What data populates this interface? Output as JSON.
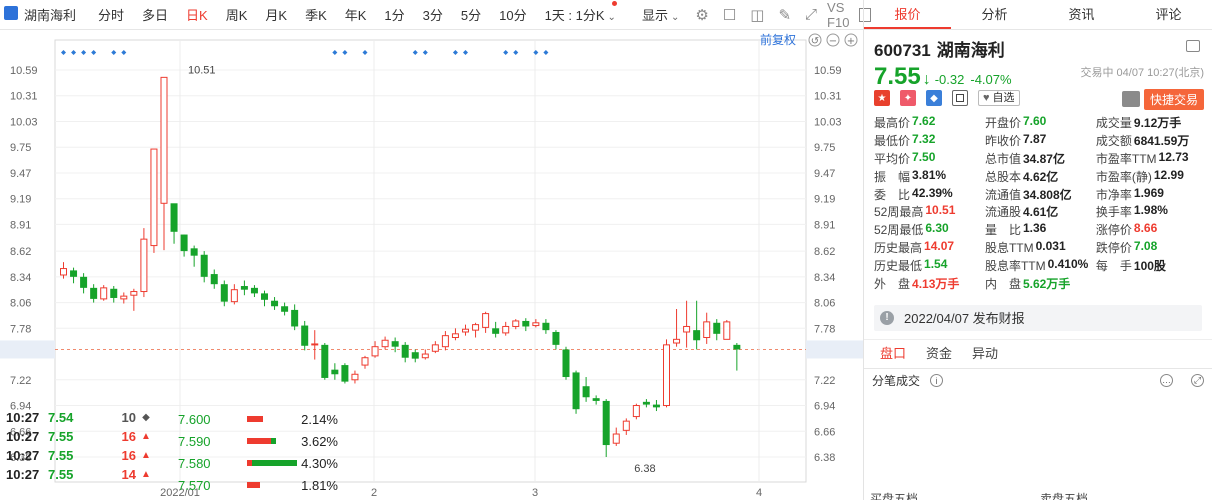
{
  "toolbar": {
    "title": "湖南海利",
    "items": [
      "分时",
      "多日",
      "日K",
      "周K",
      "月K",
      "季K",
      "年K",
      "1分",
      "3分",
      "5分",
      "10分",
      "1天 : 1分K"
    ],
    "active": "日K",
    "display": "显示",
    "vs_fio": "VS F10"
  },
  "chart_overlay": {
    "fq": "前复权",
    "high_label": "10.51",
    "low_label": "6.38",
    "current_label": "7.55"
  },
  "chart_data": {
    "type": "candlestick",
    "y_ticks": [
      "10.59",
      "10.31",
      "10.03",
      "9.75",
      "9.47",
      "9.19",
      "8.91",
      "8.62",
      "8.34",
      "8.06",
      "7.78",
      "7.55",
      "7.22",
      "6.94",
      "6.66",
      "6.38"
    ],
    "x_ticks": [
      "2022/01",
      "2",
      "3",
      "4"
    ],
    "current_price": 7.55,
    "candles": [
      {
        "o": 8.36,
        "c": 8.43,
        "h": 8.5,
        "l": 8.32
      },
      {
        "o": 8.41,
        "c": 8.34,
        "h": 8.44,
        "l": 8.27
      },
      {
        "o": 8.34,
        "c": 8.22,
        "h": 8.38,
        "l": 8.16
      },
      {
        "o": 8.22,
        "c": 8.1,
        "h": 8.26,
        "l": 8.06
      },
      {
        "o": 8.1,
        "c": 8.22,
        "h": 8.25,
        "l": 8.08
      },
      {
        "o": 8.21,
        "c": 8.11,
        "h": 8.24,
        "l": 8.06
      },
      {
        "o": 8.1,
        "c": 8.13,
        "h": 8.17,
        "l": 8.05
      },
      {
        "o": 8.14,
        "c": 8.18,
        "h": 8.21,
        "l": 7.97
      },
      {
        "o": 8.18,
        "c": 8.75,
        "h": 8.87,
        "l": 8.12
      },
      {
        "o": 8.68,
        "c": 9.73,
        "h": 9.73,
        "l": 8.6
      },
      {
        "o": 9.14,
        "c": 10.51,
        "h": 10.51,
        "l": 8.63
      },
      {
        "o": 9.14,
        "c": 8.83,
        "h": 9.08,
        "l": 8.7
      },
      {
        "o": 8.8,
        "c": 8.62,
        "h": 8.8,
        "l": 8.56
      },
      {
        "o": 8.65,
        "c": 8.57,
        "h": 8.68,
        "l": 8.45
      },
      {
        "o": 8.58,
        "c": 8.34,
        "h": 8.62,
        "l": 8.28
      },
      {
        "o": 8.37,
        "c": 8.26,
        "h": 8.42,
        "l": 8.21
      },
      {
        "o": 8.26,
        "c": 8.07,
        "h": 8.3,
        "l": 8.02
      },
      {
        "o": 8.07,
        "c": 8.2,
        "h": 8.26,
        "l": 8.04
      },
      {
        "o": 8.24,
        "c": 8.2,
        "h": 8.3,
        "l": 8.14
      },
      {
        "o": 8.22,
        "c": 8.16,
        "h": 8.25,
        "l": 8.12
      },
      {
        "o": 8.16,
        "c": 8.09,
        "h": 8.19,
        "l": 8.02
      },
      {
        "o": 8.08,
        "c": 8.02,
        "h": 8.12,
        "l": 7.98
      },
      {
        "o": 8.02,
        "c": 7.96,
        "h": 8.06,
        "l": 7.92
      },
      {
        "o": 7.98,
        "c": 7.8,
        "h": 8.04,
        "l": 7.76
      },
      {
        "o": 7.81,
        "c": 7.59,
        "h": 7.86,
        "l": 7.54
      },
      {
        "o": 7.61,
        "c": 7.61,
        "h": 7.76,
        "l": 7.44
      },
      {
        "o": 7.6,
        "c": 7.24,
        "h": 7.62,
        "l": 7.22
      },
      {
        "o": 7.33,
        "c": 7.28,
        "h": 7.4,
        "l": 7.22
      },
      {
        "o": 7.38,
        "c": 7.2,
        "h": 7.4,
        "l": 7.18
      },
      {
        "o": 7.22,
        "c": 7.28,
        "h": 7.32,
        "l": 7.18
      },
      {
        "o": 7.38,
        "c": 7.46,
        "h": 7.48,
        "l": 7.34
      },
      {
        "o": 7.48,
        "c": 7.58,
        "h": 7.64,
        "l": 7.46
      },
      {
        "o": 7.58,
        "c": 7.65,
        "h": 7.69,
        "l": 7.55
      },
      {
        "o": 7.64,
        "c": 7.58,
        "h": 7.68,
        "l": 7.52
      },
      {
        "o": 7.6,
        "c": 7.46,
        "h": 7.63,
        "l": 7.41
      },
      {
        "o": 7.52,
        "c": 7.45,
        "h": 7.55,
        "l": 7.41
      },
      {
        "o": 7.46,
        "c": 7.5,
        "h": 7.55,
        "l": 7.44
      },
      {
        "o": 7.53,
        "c": 7.6,
        "h": 7.64,
        "l": 7.51
      },
      {
        "o": 7.58,
        "c": 7.7,
        "h": 7.75,
        "l": 7.54
      },
      {
        "o": 7.68,
        "c": 7.72,
        "h": 7.78,
        "l": 7.65
      },
      {
        "o": 7.74,
        "c": 7.77,
        "h": 7.82,
        "l": 7.7
      },
      {
        "o": 7.76,
        "c": 7.82,
        "h": 7.84,
        "l": 7.68
      },
      {
        "o": 7.79,
        "c": 7.94,
        "h": 7.96,
        "l": 7.73
      },
      {
        "o": 7.78,
        "c": 7.72,
        "h": 7.85,
        "l": 7.68
      },
      {
        "o": 7.73,
        "c": 7.8,
        "h": 7.85,
        "l": 7.7
      },
      {
        "o": 7.8,
        "c": 7.86,
        "h": 7.88,
        "l": 7.77
      },
      {
        "o": 7.86,
        "c": 7.8,
        "h": 7.89,
        "l": 7.75
      },
      {
        "o": 7.81,
        "c": 7.84,
        "h": 7.88,
        "l": 7.79
      },
      {
        "o": 7.84,
        "c": 7.76,
        "h": 7.88,
        "l": 7.72
      },
      {
        "o": 7.74,
        "c": 7.6,
        "h": 7.76,
        "l": 7.55
      },
      {
        "o": 7.55,
        "c": 7.25,
        "h": 7.58,
        "l": 7.22
      },
      {
        "o": 7.3,
        "c": 6.9,
        "h": 7.32,
        "l": 6.85
      },
      {
        "o": 7.15,
        "c": 7.03,
        "h": 7.25,
        "l": 6.98
      },
      {
        "o": 7.02,
        "c": 6.99,
        "h": 7.05,
        "l": 6.95
      },
      {
        "o": 6.99,
        "c": 6.51,
        "h": 7.01,
        "l": 6.38
      },
      {
        "o": 6.53,
        "c": 6.63,
        "h": 6.7,
        "l": 6.5
      },
      {
        "o": 6.67,
        "c": 6.77,
        "h": 6.8,
        "l": 6.62
      },
      {
        "o": 6.82,
        "c": 6.94,
        "h": 6.96,
        "l": 6.79
      },
      {
        "o": 6.98,
        "c": 6.95,
        "h": 7.01,
        "l": 6.92
      },
      {
        "o": 6.95,
        "c": 6.92,
        "h": 7.0,
        "l": 6.88
      },
      {
        "o": 6.94,
        "c": 7.6,
        "h": 7.66,
        "l": 6.92
      },
      {
        "o": 7.62,
        "c": 7.66,
        "h": 7.99,
        "l": 7.58
      },
      {
        "o": 7.74,
        "c": 7.8,
        "h": 8.08,
        "l": 7.57
      },
      {
        "o": 7.76,
        "c": 7.65,
        "h": 8.08,
        "l": 7.55
      },
      {
        "o": 7.68,
        "c": 7.85,
        "h": 7.95,
        "l": 7.61
      },
      {
        "o": 7.84,
        "c": 7.72,
        "h": 7.88,
        "l": 7.65
      },
      {
        "o": 7.66,
        "c": 7.85,
        "h": 7.87,
        "l": 7.66
      },
      {
        "o": 7.6,
        "c": 7.55,
        "h": 7.62,
        "l": 7.32
      }
    ],
    "markers_x": [
      0,
      1,
      2,
      3,
      5,
      6,
      27,
      28,
      30,
      35,
      36,
      39,
      40,
      44,
      45,
      47,
      48
    ]
  },
  "quote_tabs": [
    "报价",
    "分析",
    "资讯",
    "评论"
  ],
  "quote_active": "报价",
  "stock": {
    "code": "600731",
    "name": "湖南海利",
    "price": "7.55",
    "change": "-0.32",
    "change_pct": "-4.07%",
    "time": "交易中 04/07 10:27(北京)",
    "zixuan": "自选",
    "quick_trade": "快捷交易"
  },
  "stats": [
    [
      [
        "最高价",
        "7.62",
        "green"
      ],
      [
        "开盘价",
        "7.60",
        "green"
      ],
      [
        "成交量",
        "9.12万手",
        ""
      ]
    ],
    [
      [
        "最低价",
        "7.32",
        "green"
      ],
      [
        "昨收价",
        "7.87",
        ""
      ],
      [
        "成交额",
        "6841.59万",
        ""
      ]
    ],
    [
      [
        "平均价",
        "7.50",
        "green"
      ],
      [
        "总市值",
        "34.87亿",
        ""
      ],
      [
        "市盈率TTM",
        "12.73",
        ""
      ]
    ],
    [
      [
        "振　幅",
        "3.81%",
        ""
      ],
      [
        "总股本",
        "4.62亿",
        ""
      ],
      [
        "市盈率(静)",
        "12.99",
        ""
      ]
    ],
    [
      [
        "委　比",
        "42.39%",
        ""
      ],
      [
        "流通值",
        "34.808亿",
        ""
      ],
      [
        "市净率",
        "1.969",
        ""
      ]
    ],
    [
      [
        "52周最高",
        "10.51",
        "red"
      ],
      [
        "流通股",
        "4.61亿",
        ""
      ],
      [
        "换手率",
        "1.98%",
        ""
      ]
    ],
    [
      [
        "52周最低",
        "6.30",
        "green"
      ],
      [
        "量　比",
        "1.36",
        ""
      ],
      [
        "涨停价",
        "8.66",
        "red"
      ]
    ],
    [
      [
        "历史最高",
        "14.07",
        "red"
      ],
      [
        "股息TTM",
        "0.031",
        ""
      ],
      [
        "跌停价",
        "7.08",
        "green"
      ]
    ],
    [
      [
        "历史最低",
        "1.54",
        "green"
      ],
      [
        "股息率TTM",
        "0.410%",
        ""
      ],
      [
        "每　手",
        "100股",
        ""
      ]
    ],
    [
      [
        "外　盘",
        "4.13万手",
        "red"
      ],
      [
        "内　盘",
        "5.62万手",
        "green"
      ],
      [
        "",
        "",
        ""
      ]
    ]
  ],
  "announcement": "2022/04/07  发布财报",
  "sub_tabs": [
    "盘口",
    "资金",
    "异动"
  ],
  "sub_active": "盘口",
  "trades_title": "分笔成交",
  "trades": [
    {
      "t": "10:27",
      "p": "7.54",
      "v": "10",
      "d": "◆",
      "c": "gray"
    },
    {
      "t": "10:27",
      "p": "7.55",
      "v": "16",
      "d": "▲",
      "c": "red"
    },
    {
      "t": "10:27",
      "p": "7.55",
      "v": "16",
      "d": "▲",
      "c": "red"
    },
    {
      "t": "10:27",
      "p": "7.55",
      "v": "14",
      "d": "▲",
      "c": "red"
    }
  ],
  "depth": [
    {
      "p": "7.600",
      "pct": "2.14%",
      "r": 0.3,
      "g": 0.0
    },
    {
      "p": "7.590",
      "pct": "3.62%",
      "r": 0.45,
      "g": 0.1
    },
    {
      "p": "7.580",
      "pct": "4.30%",
      "r": 0.1,
      "g": 0.85
    },
    {
      "p": "7.570",
      "pct": "1.81%",
      "r": 0.25,
      "g": 0.0
    }
  ],
  "bottom_labels": [
    "买盘五档",
    "卖盘五档"
  ]
}
